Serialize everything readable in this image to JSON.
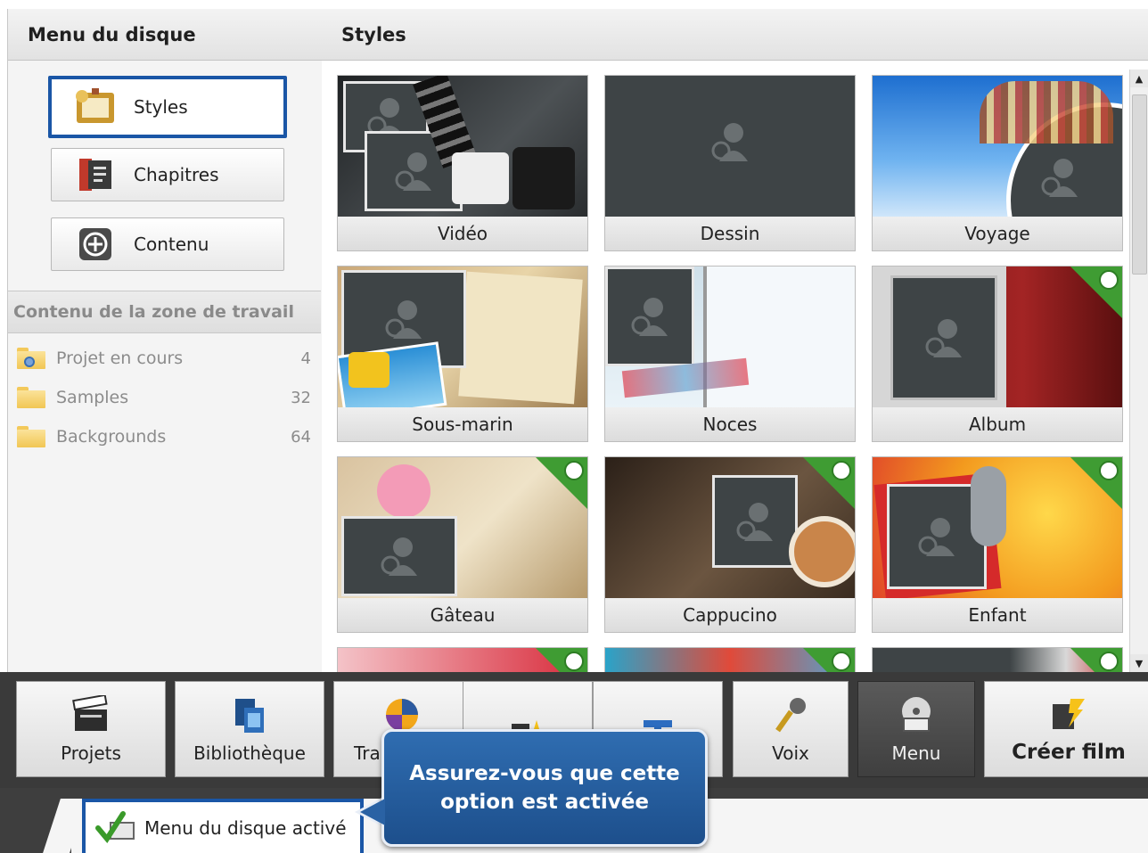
{
  "sidebar": {
    "title": "Menu du disque",
    "buttons": [
      {
        "label": "Styles",
        "icon": "frame-icon",
        "active": true
      },
      {
        "label": "Chapitres",
        "icon": "chapter-book-icon",
        "active": false
      },
      {
        "label": "Contenu",
        "icon": "add-circle-icon",
        "active": false
      }
    ],
    "workarea_title": "Contenu de la zone de travail",
    "folders": [
      {
        "name": "Projet en cours",
        "count": "4",
        "icon": "project-folder-icon"
      },
      {
        "name": "Samples",
        "count": "32",
        "icon": "folder-icon"
      },
      {
        "name": "Backgrounds",
        "count": "64",
        "icon": "folder-icon"
      }
    ]
  },
  "main": {
    "title": "Styles",
    "styles": [
      {
        "label": "Vidéo"
      },
      {
        "label": "Dessin"
      },
      {
        "label": "Voyage"
      },
      {
        "label": "Sous-marin"
      },
      {
        "label": "Noces"
      },
      {
        "label": "Album",
        "downloadable": true
      },
      {
        "label": "Gâteau",
        "downloadable": true
      },
      {
        "label": "Cappucino",
        "downloadable": true
      },
      {
        "label": "Enfant",
        "downloadable": true
      }
    ]
  },
  "toolbar": {
    "buttons": [
      {
        "label": "Projets",
        "icon": "clapperboard-icon"
      },
      {
        "label": "Bibliothèque",
        "icon": "filmstrip-icon"
      },
      {
        "label": "Tra",
        "icon": "transition-swirl-icon"
      },
      {
        "label": "",
        "icon": "effects-star-icon"
      },
      {
        "label": "",
        "icon": "text-t-icon"
      },
      {
        "label": "Voix",
        "icon": "microphone-icon"
      },
      {
        "label": "Menu",
        "icon": "disc-menu-icon",
        "active": true
      },
      {
        "label": "Créer film",
        "icon": "create-film-icon"
      }
    ]
  },
  "bottom": {
    "checkbox_label": "Menu du disque activé",
    "checked": true
  },
  "callout": {
    "text": "Assurez-vous que cette option est activée"
  },
  "colors": {
    "accent_blue": "#1a56a6",
    "download_green": "#3f9c33",
    "toolbar_dark": "#3a3a3a"
  }
}
